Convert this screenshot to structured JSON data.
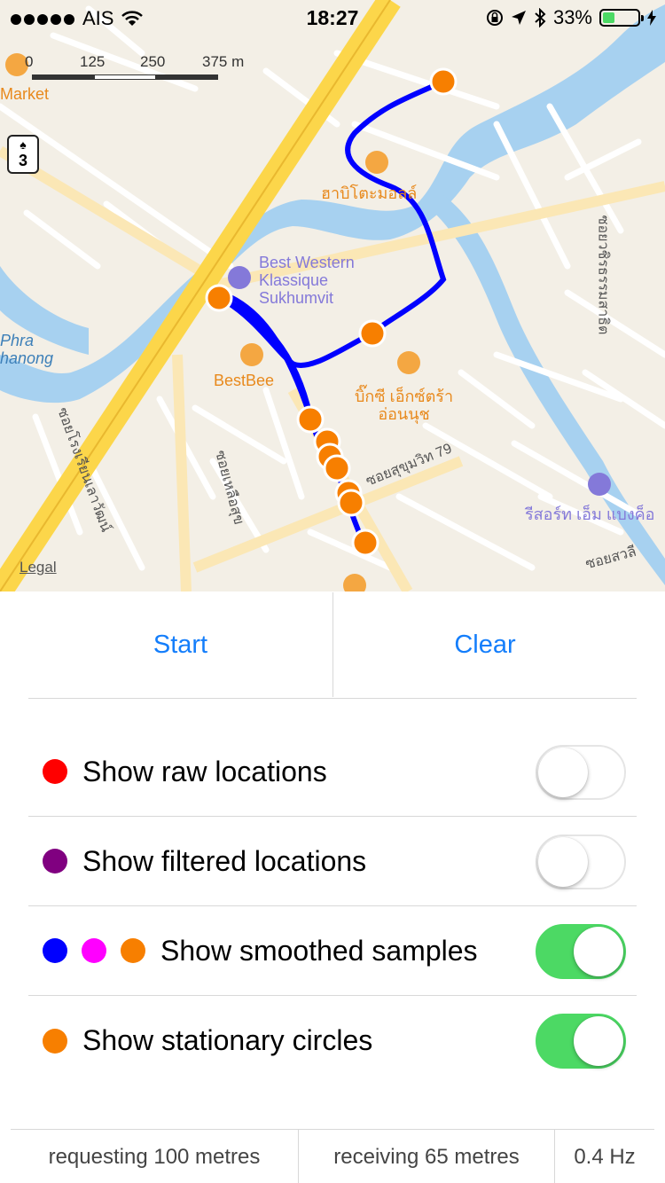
{
  "status_bar": {
    "carrier": "AIS",
    "time": "18:27",
    "battery_percent": "33%",
    "battery_level": 0.33,
    "icons": [
      "signal-dots-icon",
      "wifi-icon",
      "orientation-lock-icon",
      "location-arrow-icon",
      "bluetooth-icon",
      "battery-icon"
    ]
  },
  "map": {
    "scale_labels": [
      "0",
      "125",
      "250",
      "375 m"
    ],
    "route_shield": "3",
    "labels": {
      "market": "Market",
      "habito": "ฮาบิโตะมอลล์",
      "best_western": "Best Western\nKlassique\nSukhumvit",
      "phra_khanong": "Phra\nhanong",
      "bestbeer": "BestBee",
      "big_c": "บิ๊กซี เอ็กซ์ตร้า\nอ่อนนุช",
      "soi_79": "ซอยสุขุมวิท 79",
      "resort": "รีสอร์ท เอ็ม แบงค็อ",
      "soi_wachira": "ซอยวชิรธรรมสาธิต",
      "soi_left": "ซอยโรงเรียนเลาวัฒน์",
      "soi_mid": "ซอยเหลือสุข",
      "soi_right": "ซอยสวลี",
      "legal": "Legal"
    },
    "colors": {
      "path": "#0000ff",
      "stationary": "#f77f00",
      "main_road": "#fcd64a",
      "water": "#a7d1f0"
    }
  },
  "controls": {
    "start_label": "Start",
    "clear_label": "Clear"
  },
  "toggles": [
    {
      "label": "Show raw locations",
      "on": false,
      "dots": [
        "#ff0000"
      ]
    },
    {
      "label": "Show filtered locations",
      "on": false,
      "dots": [
        "#800080"
      ]
    },
    {
      "label": "Show smoothed samples",
      "on": true,
      "dots": [
        "#0000ff",
        "#ff00ff",
        "#f77f00"
      ]
    },
    {
      "label": "Show stationary circles",
      "on": true,
      "dots": [
        "#f77f00"
      ]
    }
  ],
  "footer": {
    "requesting": "requesting 100 metres",
    "receiving": "receiving 65 metres",
    "frequency": "0.4 Hz"
  }
}
